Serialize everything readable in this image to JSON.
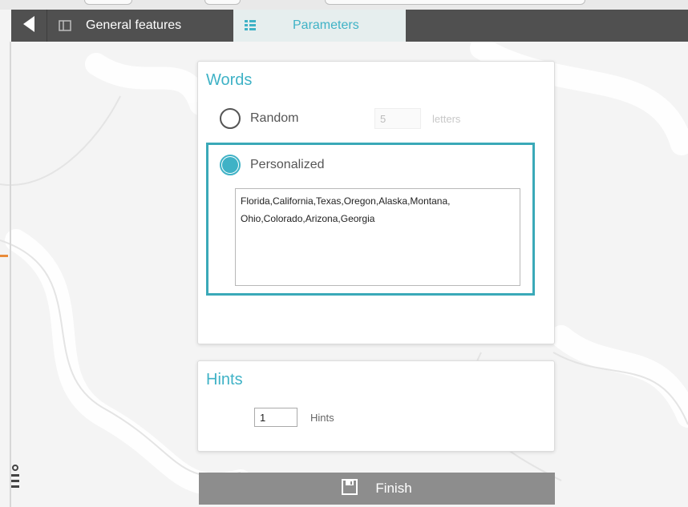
{
  "tabs": {
    "general_label": "General features",
    "parameters_label": "Parameters"
  },
  "words": {
    "title": "Words",
    "random_label": "Random",
    "random_letters_value": "5",
    "letters_unit": "letters",
    "personalized_label": "Personalized",
    "personalized_text": "Florida,California,Texas,Oregon,Alaska,Montana,\nOhio,Colorado,Arizona,Georgia",
    "selected": "personalized"
  },
  "hints": {
    "title": "Hints",
    "value": "1",
    "unit": "Hints"
  },
  "finish": {
    "label": "Finish"
  },
  "icons": {
    "back": "back-arrow-icon",
    "general": "panel-icon",
    "parameters": "list-icon",
    "finish": "save-icon"
  },
  "colors": {
    "accent": "#3fb2c6",
    "highlight_border": "#3aa9b8",
    "tabbar": "#505050",
    "finish_button": "#8d8d8d"
  }
}
